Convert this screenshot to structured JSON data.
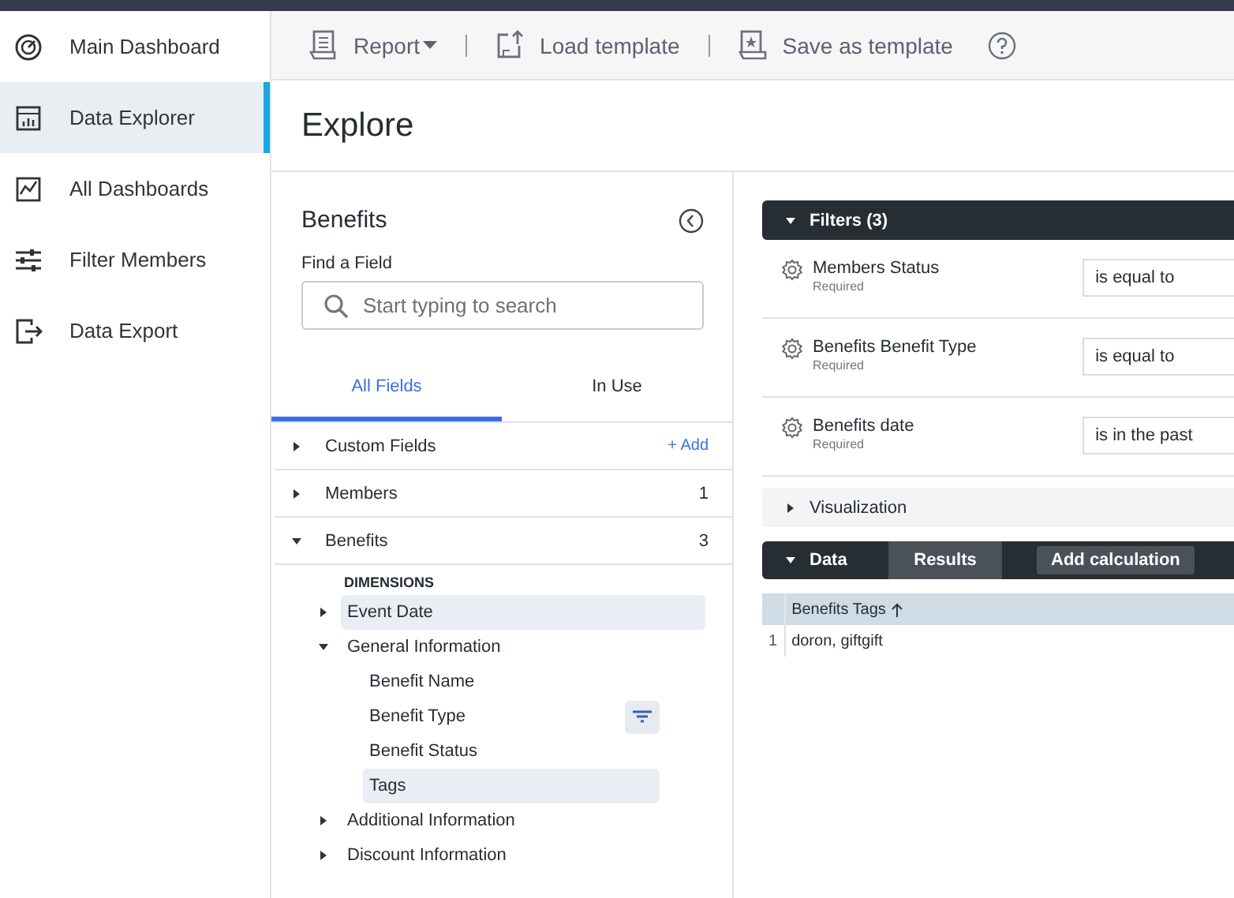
{
  "sidebar": {
    "items": [
      {
        "label": "Main Dashboard",
        "selected": false
      },
      {
        "label": "Data Explorer",
        "selected": true
      },
      {
        "label": "All Dashboards",
        "selected": false
      },
      {
        "label": "Filter Members",
        "selected": false
      },
      {
        "label": "Data Export",
        "selected": false
      }
    ]
  },
  "toolbar": {
    "items": [
      {
        "label": "Report",
        "kind": "dropdown"
      },
      {
        "label": "Load template",
        "kind": "button"
      },
      {
        "label": "Save as template",
        "kind": "button"
      }
    ]
  },
  "page_title": "Explore",
  "field_picker": {
    "title": "Benefits",
    "search_label": "Find a Field",
    "search": {
      "placeholder": "Start typing to search"
    },
    "tabs": [
      {
        "label": "All Fields",
        "selected": true
      },
      {
        "label": "In Use",
        "selected": false
      }
    ],
    "groups": [
      {
        "label": "Custom Fields",
        "expanded": false,
        "action": "+ Add"
      },
      {
        "label": "Members",
        "expanded": false,
        "count": "1"
      },
      {
        "label": "Benefits",
        "expanded": true,
        "count": "3",
        "heading": "DIMENSIONS",
        "children": [
          {
            "label": "Event Date",
            "expanded": false,
            "selected": true
          },
          {
            "label": "General Information",
            "expanded": true,
            "selected": false,
            "children": [
              {
                "label": "Benefit Name",
                "selected": false,
                "filtered": false
              },
              {
                "label": "Benefit Type",
                "selected": false,
                "filtered": true
              },
              {
                "label": "Benefit Status",
                "selected": false,
                "filtered": false
              },
              {
                "label": "Tags",
                "selected": true,
                "filtered": false
              }
            ]
          },
          {
            "label": "Additional Information",
            "expanded": false,
            "selected": false
          },
          {
            "label": "Discount Information",
            "expanded": false,
            "selected": false
          }
        ]
      }
    ]
  },
  "filters": {
    "title": "Filters (3)",
    "expanded": true,
    "rows": [
      {
        "field": "Members Status",
        "note": "Required",
        "operator": "is equal to"
      },
      {
        "field": "Benefits Benefit Type",
        "note": "Required",
        "operator": "is equal to"
      },
      {
        "field": "Benefits date",
        "note": "Required",
        "operator": "is in the past"
      }
    ]
  },
  "visualization": {
    "title": "Visualization",
    "expanded": false
  },
  "data": {
    "title": "Data",
    "expanded": true,
    "tabs": [
      {
        "label": "Results",
        "selected": true
      }
    ],
    "action": "Add calculation",
    "table": {
      "columns": [
        {
          "label": "Benefits Tags",
          "sorted": true
        }
      ],
      "rows": [
        {
          "index": "1",
          "cells": [
            "doron, giftgift"
          ]
        }
      ]
    }
  }
}
